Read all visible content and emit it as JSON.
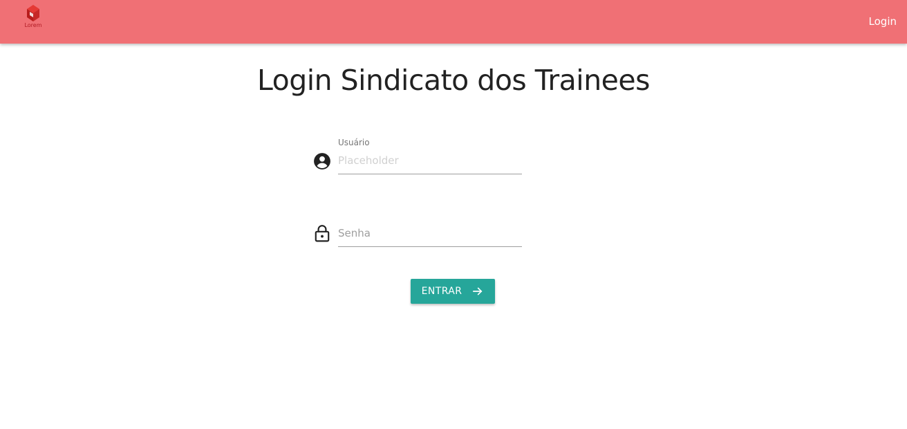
{
  "header": {
    "logo_text": "Lorem",
    "login_link": "Login"
  },
  "page": {
    "title": "Login Sindicato dos Trainees"
  },
  "form": {
    "username": {
      "label": "Usuário",
      "placeholder": "Placeholder",
      "value": "",
      "icon": "account-circle-icon"
    },
    "password": {
      "placeholder": "Senha",
      "value": "",
      "icon": "lock-icon"
    },
    "submit": {
      "label": "ENTRAR",
      "icon": "arrow-right-icon"
    }
  },
  "colors": {
    "appbar": "#f07075",
    "button": "#26a69a",
    "logo": "#d32f2f"
  }
}
